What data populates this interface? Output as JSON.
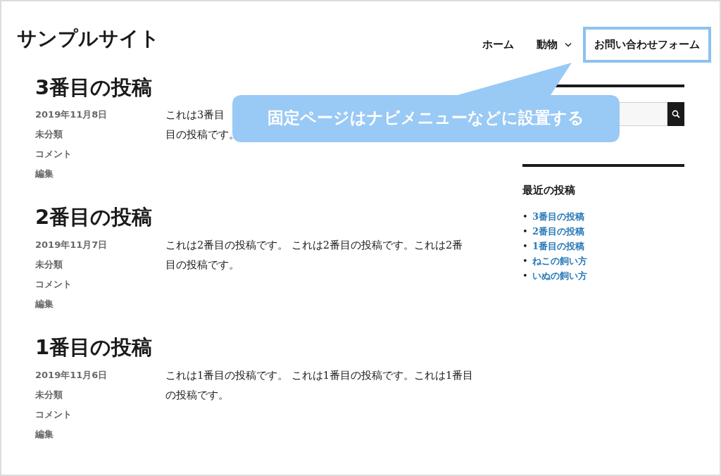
{
  "site_title": "サンプルサイト",
  "nav": [
    {
      "label": "ホーム",
      "dropdown": false,
      "highlighted": false
    },
    {
      "label": "動物",
      "dropdown": true,
      "highlighted": false
    },
    {
      "label": "お問い合わせフォーム",
      "dropdown": false,
      "highlighted": true
    }
  ],
  "callout": {
    "text": "固定ページはナビメニューなどに設置する"
  },
  "posts": [
    {
      "title": "3番目の投稿",
      "date": "2019年11月8日",
      "category": "未分類",
      "comments": "コメント",
      "edit": "編集",
      "excerpt_lines": [
        "これは3番目",
        "目の投稿です。"
      ]
    },
    {
      "title": "2番目の投稿",
      "date": "2019年11月7日",
      "category": "未分類",
      "comments": "コメント",
      "edit": "編集",
      "excerpt_lines": [
        "これは2番目の投稿です。 これは2番目の投稿です。これは2番",
        "目の投稿です。"
      ]
    },
    {
      "title": "1番目の投稿",
      "date": "2019年11月6日",
      "category": "未分類",
      "comments": "コメント",
      "edit": "編集",
      "excerpt_lines": [
        "これは1番目の投稿です。 これは1番目の投稿です。これは1番目",
        "の投稿です。"
      ]
    }
  ],
  "sidebar": {
    "recent_posts": {
      "title": "最近の投稿",
      "items": [
        {
          "marker": "•",
          "label": "3番目の投稿"
        },
        {
          "marker": "•",
          "label": "2番目の投稿"
        },
        {
          "marker": "•",
          "label": "1番目の投稿"
        },
        {
          "marker": "•",
          "label": "ねこの飼い方"
        },
        {
          "marker": "•",
          "label": "いぬの飼い方"
        }
      ]
    }
  }
}
